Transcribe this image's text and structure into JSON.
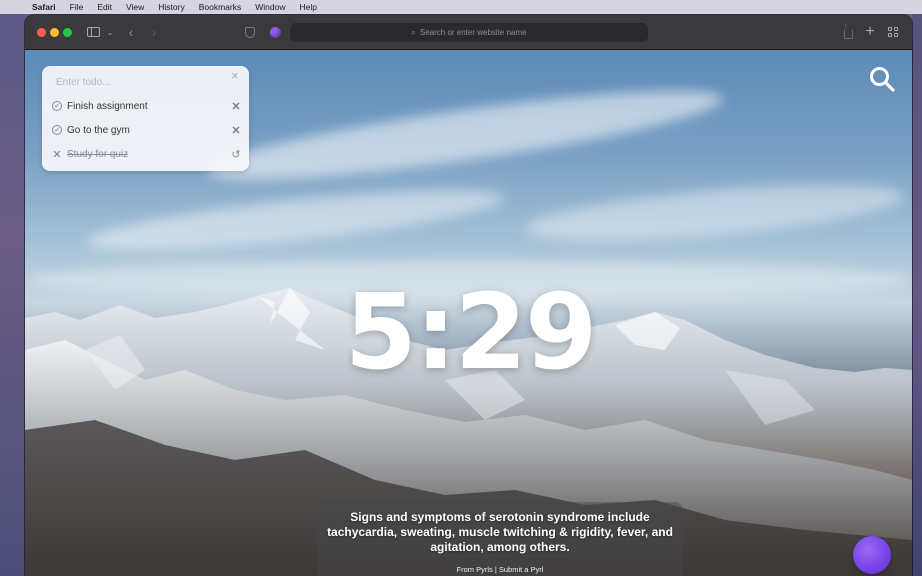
{
  "menubar": {
    "apple_icon": "apple-icon",
    "items": [
      "Safari",
      "File",
      "Edit",
      "View",
      "History",
      "Bookmarks",
      "Window",
      "Help"
    ]
  },
  "browser": {
    "address_placeholder": "Search or enter website name"
  },
  "todo": {
    "input_placeholder": "Enter todo...",
    "items": [
      {
        "label": "Finish assignment",
        "done": false
      },
      {
        "label": "Go to the gym",
        "done": false
      },
      {
        "label": "Study for quiz",
        "done": true
      }
    ]
  },
  "clock": {
    "time": "5:29"
  },
  "fact": {
    "text": "Signs and symptoms of serotonin syndrome include tachycardia, sweating, muscle twitching & rigidity, fever, and agitation, among others.",
    "source": "From Pyrls | Submit a Pyrl"
  },
  "colors": {
    "traffic_close": "#ff5f57",
    "traffic_min": "#febc2e",
    "traffic_max": "#28c840",
    "extension_purple": "#8c5cf0",
    "orb_purple": "#7a44e8"
  }
}
